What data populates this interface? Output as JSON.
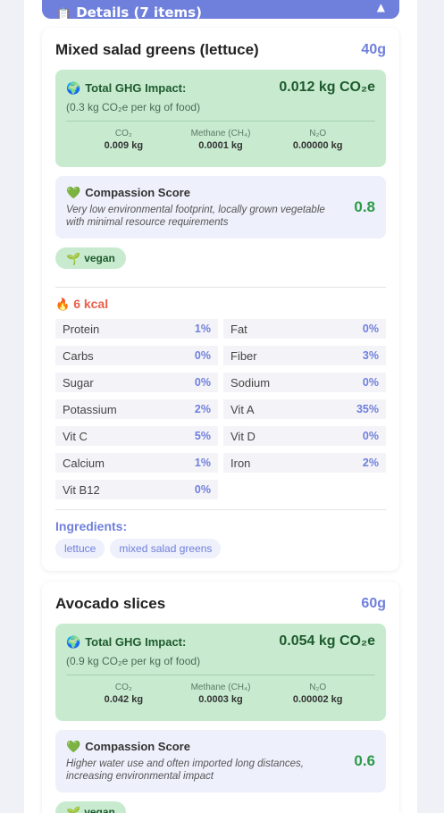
{
  "header": {
    "icon": "clipboard-icon",
    "title": "Details (7 items)",
    "chevron": "▲"
  },
  "items": [
    {
      "name": "Mixed salad greens (lettuce)",
      "weight": "40g",
      "ghg": {
        "label": "Total GHG Impact:",
        "value": "0.012 kg CO₂e",
        "per_kg": "(0.3 kg CO₂e per kg of food)",
        "gases": [
          {
            "name": "CO₂",
            "value": "0.009 kg"
          },
          {
            "name": "Methane (CH₄)",
            "value": "0.0001 kg"
          },
          {
            "name": "N₂O",
            "value": "0.00000 kg"
          }
        ]
      },
      "compassion": {
        "title": "Compassion Score",
        "description": "Very low environmental footprint, locally grown vegetable with minimal resource requirements",
        "score": "0.8"
      },
      "tag": "vegan",
      "kcal": "6 kcal",
      "nutrients": [
        {
          "name": "Protein",
          "value": "1%"
        },
        {
          "name": "Fat",
          "value": "0%"
        },
        {
          "name": "Carbs",
          "value": "0%"
        },
        {
          "name": "Fiber",
          "value": "3%"
        },
        {
          "name": "Sugar",
          "value": "0%"
        },
        {
          "name": "Sodium",
          "value": "0%"
        },
        {
          "name": "Potassium",
          "value": "2%"
        },
        {
          "name": "Vit A",
          "value": "35%"
        },
        {
          "name": "Vit C",
          "value": "5%"
        },
        {
          "name": "Vit D",
          "value": "0%"
        },
        {
          "name": "Calcium",
          "value": "1%"
        },
        {
          "name": "Iron",
          "value": "2%"
        },
        {
          "name": "Vit B12",
          "value": "0%"
        }
      ],
      "ingredients_label": "Ingredients:",
      "ingredients": [
        "lettuce",
        "mixed salad greens"
      ]
    },
    {
      "name": "Avocado slices",
      "weight": "60g",
      "ghg": {
        "label": "Total GHG Impact:",
        "value": "0.054 kg CO₂e",
        "per_kg": "(0.9 kg CO₂e per kg of food)",
        "gases": [
          {
            "name": "CO₂",
            "value": "0.042 kg"
          },
          {
            "name": "Methane (CH₄)",
            "value": "0.0003 kg"
          },
          {
            "name": "N₂O",
            "value": "0.00002 kg"
          }
        ]
      },
      "compassion": {
        "title": "Compassion Score",
        "description": "Higher water use and often imported long distances, increasing environmental impact",
        "score": "0.6"
      },
      "tag": "vegan"
    }
  ],
  "colors": {
    "accent": "#6f7fdc",
    "ghg_bg": "#c8ebd0",
    "score": "#2c9a48",
    "kcal": "#e8604c"
  }
}
